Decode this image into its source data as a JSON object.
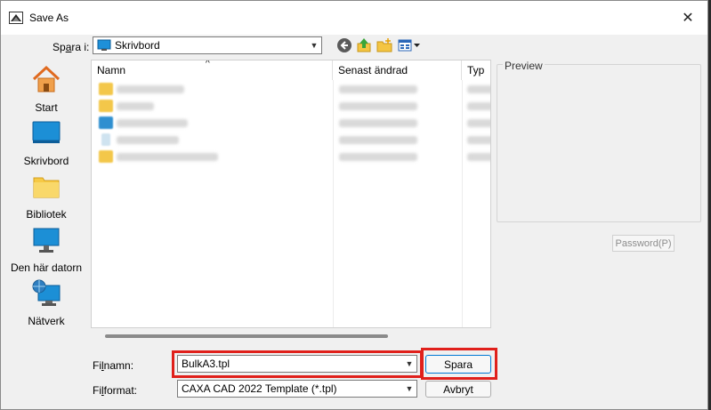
{
  "window": {
    "title": "Save As",
    "close_glyph": "✕"
  },
  "location": {
    "label": "Spara i:",
    "label_underline": "a",
    "value": "Skrivbord"
  },
  "places": [
    {
      "label": "Start",
      "icon": "home-icon"
    },
    {
      "label": "Skrivbord",
      "icon": "desktop-icon"
    },
    {
      "label": "Bibliotek",
      "icon": "library-folder-icon"
    },
    {
      "label": "Den här datorn",
      "icon": "computer-icon"
    },
    {
      "label": "Nätverk",
      "icon": "network-icon"
    }
  ],
  "filelist": {
    "columns": [
      "Namn",
      "Senast ändrad",
      "Typ"
    ]
  },
  "preview": {
    "label": "Preview",
    "password_button": "Password(P)"
  },
  "filename": {
    "label": "Filnamn:",
    "value": "BulkA3.tpl"
  },
  "fileformat": {
    "label": "Filformat:",
    "value": "CAXA CAD 2022 Template (*.tpl)"
  },
  "buttons": {
    "save": "Spara",
    "cancel": "Avbryt"
  },
  "colors": {
    "highlight_box": "#e0201b",
    "accent": "#0078d4"
  }
}
